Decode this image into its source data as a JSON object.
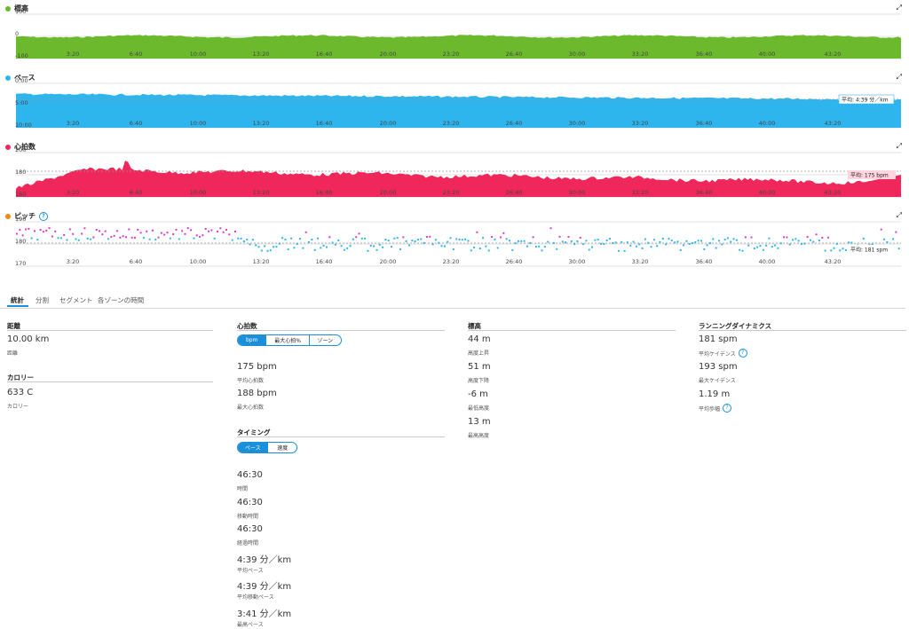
{
  "charts": [
    {
      "key": "elev",
      "title": "標高",
      "color": "#6cb92d",
      "yticks": [
        "100",
        "0",
        "-100"
      ],
      "help": false,
      "avg_label": ""
    },
    {
      "key": "pace",
      "title": "ペース",
      "color": "#2fb5ee",
      "yticks": [
        "0:00",
        "5:00",
        "10:00"
      ],
      "help": false,
      "avg_label": "平均: 4:39 分／km"
    },
    {
      "key": "hr",
      "title": "心拍数",
      "color": "#f0275a",
      "yticks": [
        "200",
        "180",
        "160"
      ],
      "help": false,
      "avg_label": "平均: 175 bpm"
    },
    {
      "key": "cad",
      "title": "ピッチ",
      "color": "#f08a00",
      "yticks": [
        "190",
        "180",
        "170"
      ],
      "help": true,
      "avg_label": "平均: 181 spm"
    }
  ],
  "xticks": [
    "3:20",
    "6:40",
    "10:00",
    "13:20",
    "16:40",
    "20:00",
    "23:20",
    "26:40",
    "30:00",
    "33:20",
    "36:40",
    "40:00",
    "43:20"
  ],
  "chart_data": [
    {
      "type": "area",
      "title": "標高",
      "x_unit": "time",
      "x_range": [
        "0:00",
        "46:30"
      ],
      "y_range": [
        -100,
        100
      ],
      "approx_level": 0
    },
    {
      "type": "area",
      "title": "ペース",
      "y_range": [
        "0:00",
        "10:00"
      ],
      "avg": "4:39 分／km",
      "approx_start": "3:42",
      "approx_end": "4:42"
    },
    {
      "type": "area",
      "title": "心拍数",
      "y_range": [
        160,
        200
      ],
      "avg": 175,
      "approx_start": 164,
      "approx_peak": 188,
      "approx_end": 172
    },
    {
      "type": "scatter",
      "title": "ピッチ",
      "y_range": [
        170,
        190
      ],
      "avg": 181
    }
  ],
  "tabs": [
    "統計",
    "分割",
    "セグメント",
    "各ゾーンの時間"
  ],
  "stats": {
    "distance": {
      "heading": "距離",
      "value": "10.00 km",
      "label": "距離"
    },
    "calories": {
      "heading": "カロリー",
      "value": "633 C",
      "label": "カロリー"
    },
    "heart": {
      "heading": "心拍数",
      "toggle": [
        "bpm",
        "最大心拍%",
        "ゾーン"
      ],
      "avg_value": "175 bpm",
      "avg_label": "平均心拍数",
      "max_value": "188 bpm",
      "max_label": "最大心拍数"
    },
    "timing": {
      "heading": "タイミング",
      "toggle": [
        "ペース",
        "速度"
      ],
      "items": [
        {
          "value": "46:30",
          "label": "時間"
        },
        {
          "value": "46:30",
          "label": "移動時間"
        },
        {
          "value": "46:30",
          "label": "経過時間"
        },
        {
          "value": "4:39 分／km",
          "label": "平均ペース"
        },
        {
          "value": "4:39 分／km",
          "label": "平均移動ペース"
        },
        {
          "value": "3:41 分／km",
          "label": "最高ペース"
        }
      ]
    },
    "elevation": {
      "heading": "標高",
      "items": [
        {
          "value": "44 m",
          "label": "高度上昇"
        },
        {
          "value": "51 m",
          "label": "高度下降"
        },
        {
          "value": "-6 m",
          "label": "最低高度"
        },
        {
          "value": "13 m",
          "label": "最高高度"
        }
      ]
    },
    "dynamics": {
      "heading": "ランニングダイナミクス",
      "items": [
        {
          "value": "181 spm",
          "label": "平均ケイデンス"
        },
        {
          "value": "193 spm",
          "label": "最大ケイデンス"
        },
        {
          "value": "1.19 m",
          "label": "平均歩幅"
        }
      ]
    }
  }
}
